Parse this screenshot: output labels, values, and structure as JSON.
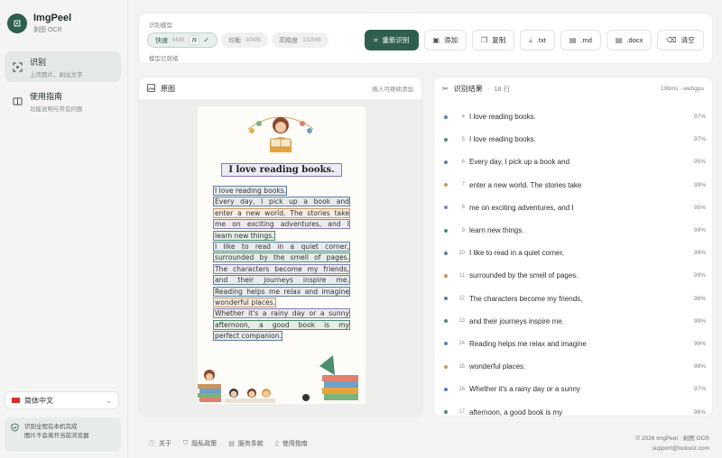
{
  "brand": {
    "name": "ImgPeel",
    "subtitle": "剥图 OCR",
    "logo_icon": "scan-plus-icon"
  },
  "sidebar": {
    "items": [
      {
        "title": "识别",
        "desc": "上传图片，剥出文字",
        "icon": "scan-icon",
        "active": true
      },
      {
        "title": "使用指南",
        "desc": "功能说明与常见问题",
        "icon": "book-icon",
        "active": false
      }
    ],
    "language": "简体中文",
    "privacy_lines": [
      "识别全程在本机完成",
      "图片不会离开当前浏览器"
    ]
  },
  "toolbar": {
    "model_label": "识别模型",
    "models": [
      {
        "name": "快速",
        "size": "6MB",
        "tag": "荐",
        "active": true
      },
      {
        "name": "均衡",
        "size": "30MB",
        "active": false
      },
      {
        "name": "高精度",
        "size": "132MB",
        "active": false
      }
    ],
    "status": "模型已就绪",
    "buttons": [
      {
        "label": "重新识别",
        "icon": "rescan-icon",
        "primary": true
      },
      {
        "label": "添加",
        "icon": "image-add-icon"
      },
      {
        "label": "复制",
        "icon": "copy-icon"
      },
      {
        "label": ".txt",
        "icon": "download-icon"
      },
      {
        "label": ".md",
        "icon": "file-icon"
      },
      {
        "label": ".docx",
        "icon": "file-icon"
      },
      {
        "label": "清空",
        "icon": "eraser-icon"
      }
    ]
  },
  "image_panel": {
    "title": "原图",
    "hint": "拖入可继续添加",
    "doc_title": "I love reading books.",
    "lines": [
      {
        "text": "I love reading books.",
        "color": "#5d7ea7"
      },
      {
        "text": "Every day, I pick up a book and",
        "color": "#5d7ea7"
      },
      {
        "text": "enter a new world. The stories take",
        "color": "#c9955e"
      },
      {
        "text": "me on exciting adventures, and I",
        "color": "#8a7bb6"
      },
      {
        "text": "learn new things.",
        "color": "#4a8e6e"
      },
      {
        "text": "I like to read in a quiet corner,",
        "color": "#5d7ea7"
      },
      {
        "text": "surrounded by the smell of pages.",
        "color": "#4a8e6e"
      },
      {
        "text": "The characters become my friends,",
        "color": "#8a7bb6"
      },
      {
        "text": "and their journeys inspire me.",
        "color": "#5d7ea7"
      },
      {
        "text": "Reading helps me relax and imagine",
        "color": "#5d7ea7"
      },
      {
        "text": "wonderful places.",
        "color": "#c9955e"
      },
      {
        "text": "Whether it's a rainy day or a sunny",
        "color": "#8a7bb6"
      },
      {
        "text": "afternoon, a good book is my",
        "color": "#4a8e6e"
      },
      {
        "text": "perfect companion.",
        "color": "#5d7ea7"
      }
    ]
  },
  "results": {
    "title": "识别结果",
    "count": "18 行",
    "timing": "196ms · webgpu",
    "rows": [
      {
        "n": "4",
        "text": "I love reading books.",
        "pct": "97%",
        "color": "#5d7ea7"
      },
      {
        "n": "5",
        "text": "I love reading books.",
        "pct": "97%",
        "color": "#4a8e6e"
      },
      {
        "n": "6",
        "text": "Every day, I pick up a book and",
        "pct": "95%",
        "color": "#5d7ea7"
      },
      {
        "n": "7",
        "text": "enter a new world. The stories take",
        "pct": "99%",
        "color": "#c9955e"
      },
      {
        "n": "8",
        "text": "me on exciting adventures, and I",
        "pct": "95%",
        "color": "#8a7bb6"
      },
      {
        "n": "9",
        "text": "learn new things.",
        "pct": "99%",
        "color": "#4a8e6e"
      },
      {
        "n": "10",
        "text": "I like to read in a quiet corner,",
        "pct": "98%",
        "color": "#5d7ea7"
      },
      {
        "n": "11",
        "text": "surrounded by the smell of pages.",
        "pct": "99%",
        "color": "#c9955e"
      },
      {
        "n": "12",
        "text": "The characters become my friends,",
        "pct": "98%",
        "color": "#5d7ea7"
      },
      {
        "n": "13",
        "text": "and their journeys inspire me.",
        "pct": "99%",
        "color": "#4a8e6e"
      },
      {
        "n": "14",
        "text": "Reading helps me relax and imagine",
        "pct": "99%",
        "color": "#5d7ea7"
      },
      {
        "n": "15",
        "text": "wonderful places.",
        "pct": "98%",
        "color": "#c9955e"
      },
      {
        "n": "16",
        "text": "Whether it's a rainy day or a sunny",
        "pct": "97%",
        "color": "#5d7ea7"
      },
      {
        "n": "17",
        "text": "afternoon, a good book is my",
        "pct": "96%",
        "color": "#4a8e6e"
      }
    ]
  },
  "footer": {
    "links": [
      {
        "label": "关于",
        "icon": "info-icon"
      },
      {
        "label": "隐私政策",
        "icon": "shield-icon"
      },
      {
        "label": "服务条款",
        "icon": "document-icon"
      },
      {
        "label": "使用指南",
        "icon": "book-icon"
      }
    ],
    "copyright": "© 2026 ImgPeel · 剥图 OCR",
    "email": "support@toolooz.com"
  },
  "colors": {
    "accent": "#2f5f4f",
    "background": "#f3f4f1"
  }
}
